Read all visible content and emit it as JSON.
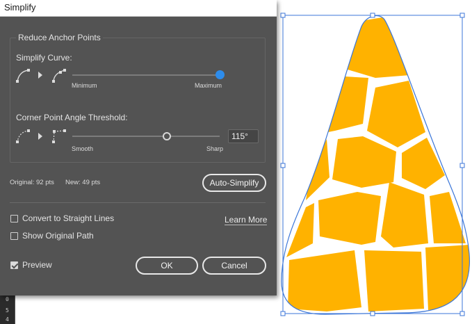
{
  "window": {
    "title": "Simplify"
  },
  "group": {
    "title": "Reduce Anchor Points",
    "simplify_curve": {
      "label": "Simplify Curve:",
      "min_label": "Minimum",
      "max_label": "Maximum",
      "value": 1.0
    },
    "corner_threshold": {
      "label": "Corner Point Angle Threshold:",
      "min_label": "Smooth",
      "max_label": "Sharp",
      "value_text": "115°",
      "value": 0.64
    }
  },
  "info": {
    "original": "Original: 92 pts",
    "new": "New: 49 pts"
  },
  "buttons": {
    "auto_simplify": "Auto-Simplify",
    "ok": "OK",
    "cancel": "Cancel"
  },
  "options": {
    "straight_lines": {
      "label": "Convert to Straight Lines",
      "checked": false
    },
    "show_original": {
      "label": "Show Original Path",
      "checked": false
    },
    "preview": {
      "label": "Preview",
      "checked": true
    },
    "learn_more": "Learn More"
  },
  "ruler": {
    "ticks": [
      "0",
      "5",
      "4"
    ]
  },
  "colors": {
    "accent": "#2d8ceb",
    "shape_fill": "#ffb200",
    "selection": "#3b76d8",
    "panel": "#535353"
  }
}
